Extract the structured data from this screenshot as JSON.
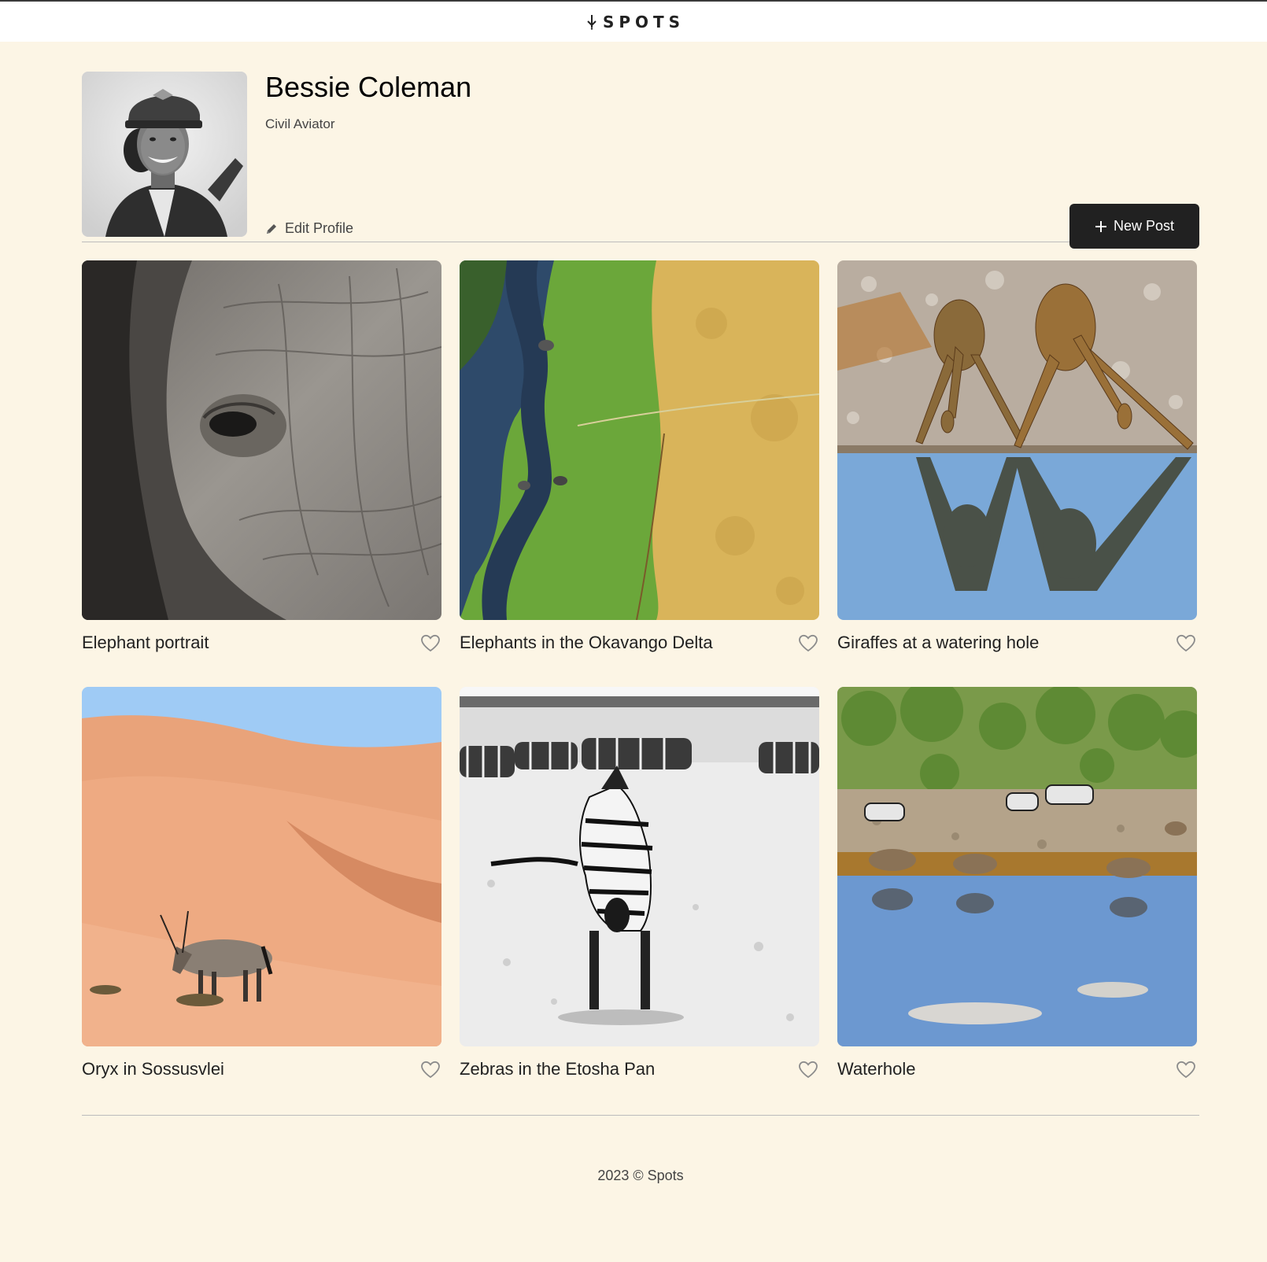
{
  "header": {
    "logo_text": "SPOTS"
  },
  "profile": {
    "name": "Bessie Coleman",
    "description": "Civil Aviator",
    "edit_label": "Edit Profile",
    "new_post_label": "New Post"
  },
  "cards": [
    {
      "title": "Elephant portrait"
    },
    {
      "title": "Elephants in the Okavango Delta"
    },
    {
      "title": "Giraffes at a watering hole"
    },
    {
      "title": "Oryx in Sossusvlei"
    },
    {
      "title": "Zebras in the Etosha Pan"
    },
    {
      "title": "Waterhole"
    }
  ],
  "footer": {
    "text": "2023 © Spots"
  },
  "colors": {
    "background": "#fcf5e5",
    "text": "#212121",
    "button": "#212121"
  }
}
